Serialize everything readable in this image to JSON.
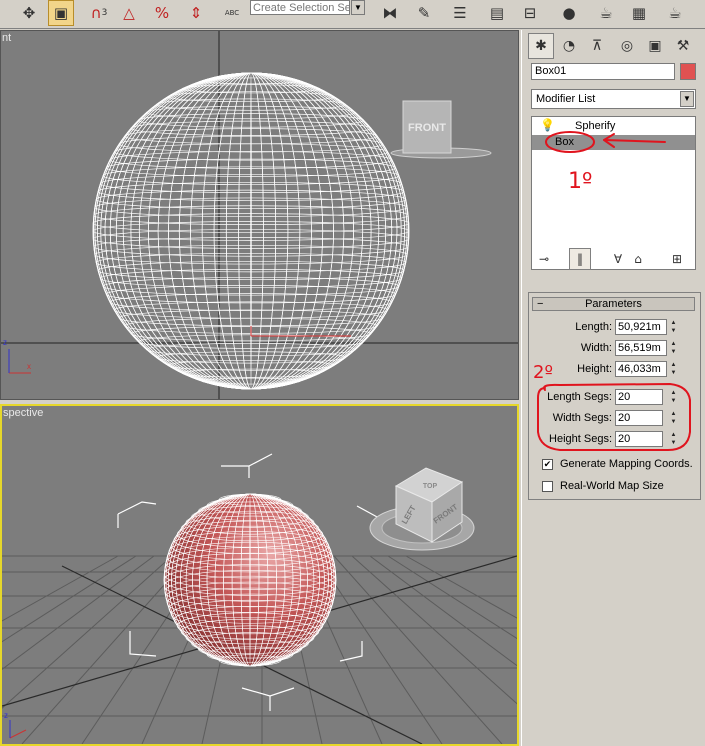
{
  "toolbar": {
    "selection_set_placeholder": "Create Selection Set",
    "snap_label": "3",
    "percent_snap_label": "%",
    "named_sel_icon_text": "ABC"
  },
  "viewports": {
    "top": {
      "label": "nt",
      "navcube_label": "FRONT"
    },
    "bottom": {
      "label": "spective",
      "navcube_labels": [
        "TOP",
        "LEFT",
        "FRONT"
      ]
    }
  },
  "command_panel": {
    "object_name": "Box01",
    "object_color": "#e05252",
    "modifier_list_label": "Modifier List",
    "stack": [
      {
        "label": "Spherify",
        "selected": false
      },
      {
        "label": "Box",
        "selected": true
      }
    ],
    "parameters": {
      "title": "Parameters",
      "fields": [
        {
          "label": "Length:",
          "value": "50,921m"
        },
        {
          "label": "Width:",
          "value": "56,519m"
        },
        {
          "label": "Height:",
          "value": "46,033m"
        },
        {
          "label": "Length Segs:",
          "value": "20"
        },
        {
          "label": "Width Segs:",
          "value": "20"
        },
        {
          "label": "Height Segs:",
          "value": "20"
        }
      ],
      "checkboxes": [
        {
          "label": "Generate Mapping Coords.",
          "checked": true
        },
        {
          "label": "Real-World Map Size",
          "checked": false
        }
      ]
    }
  },
  "annotations": {
    "note_1": "1º",
    "note_2": "2º",
    "color": "#e0141e"
  }
}
